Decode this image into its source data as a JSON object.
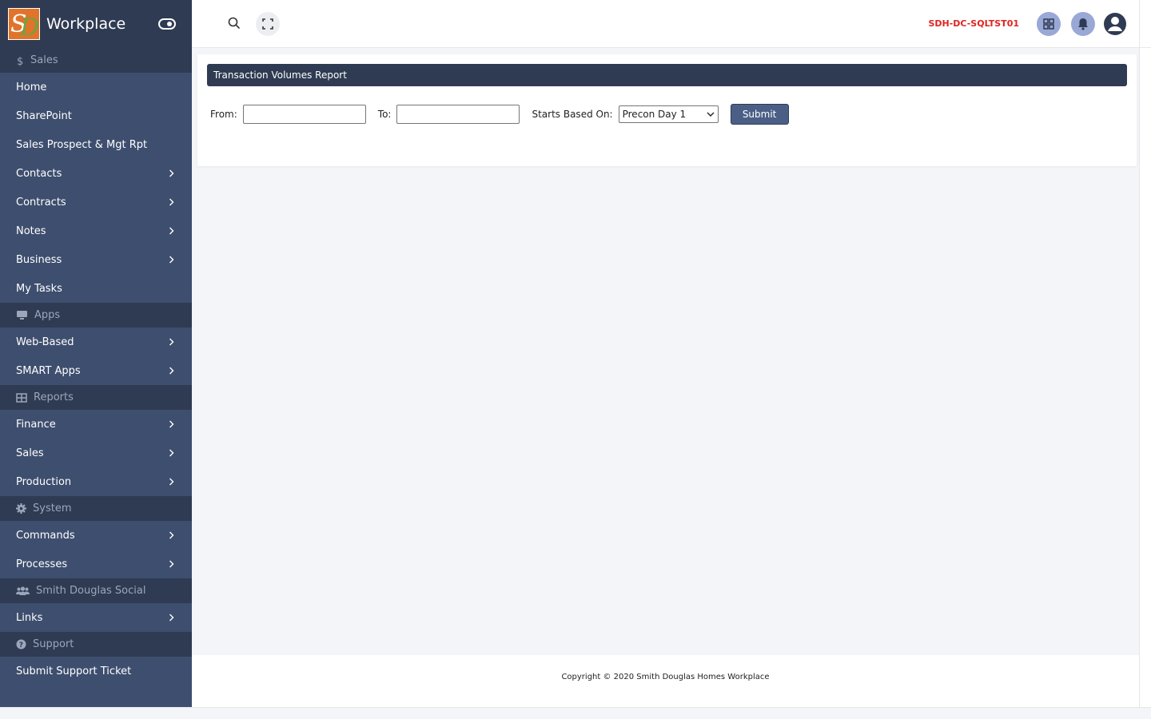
{
  "brand": {
    "title": "Workplace",
    "logo_initials": "SD"
  },
  "sidebar": {
    "sections": [
      {
        "title": "Sales",
        "icon": "dollar-icon",
        "items": [
          {
            "label": "Home",
            "chevron": false
          },
          {
            "label": "SharePoint",
            "chevron": false
          },
          {
            "label": "Sales Prospect & Mgt Rpt",
            "chevron": false
          },
          {
            "label": "Contacts",
            "chevron": true
          },
          {
            "label": "Contracts",
            "chevron": true
          },
          {
            "label": "Notes",
            "chevron": true
          },
          {
            "label": "Business",
            "chevron": true
          },
          {
            "label": "My Tasks",
            "chevron": false
          }
        ]
      },
      {
        "title": "Apps",
        "icon": "monitor-icon",
        "items": [
          {
            "label": "Web-Based",
            "chevron": true
          },
          {
            "label": "SMART Apps",
            "chevron": true
          }
        ]
      },
      {
        "title": "Reports",
        "icon": "table-icon",
        "items": [
          {
            "label": "Finance",
            "chevron": true
          },
          {
            "label": "Sales",
            "chevron": true
          },
          {
            "label": "Production",
            "chevron": true
          }
        ]
      },
      {
        "title": "System",
        "icon": "gear-icon",
        "items": [
          {
            "label": "Commands",
            "chevron": true
          },
          {
            "label": "Processes",
            "chevron": true
          }
        ]
      },
      {
        "title": "Smith Douglas Social",
        "icon": "users-icon",
        "items": [
          {
            "label": "Links",
            "chevron": true
          }
        ]
      },
      {
        "title": "Support",
        "icon": "question-icon",
        "items": [
          {
            "label": "Submit Support Ticket",
            "chevron": false
          }
        ]
      }
    ]
  },
  "topbar": {
    "server_name": "SDH-DC-SQLTST01"
  },
  "report": {
    "title": "Transaction Volumes Report",
    "from_label": "From:",
    "from_value": "",
    "to_label": "To:",
    "to_value": "",
    "starts_label": "Starts Based On:",
    "starts_value": "Precon Day 1",
    "submit_label": "Submit"
  },
  "footer": {
    "copyright": "Copyright © 2020 Smith Douglas Homes Workplace"
  },
  "colors": {
    "sidebar": "#3e4e6e",
    "section": "#2f3b52",
    "accent": "#4b5f86",
    "server": "#e0231f"
  }
}
